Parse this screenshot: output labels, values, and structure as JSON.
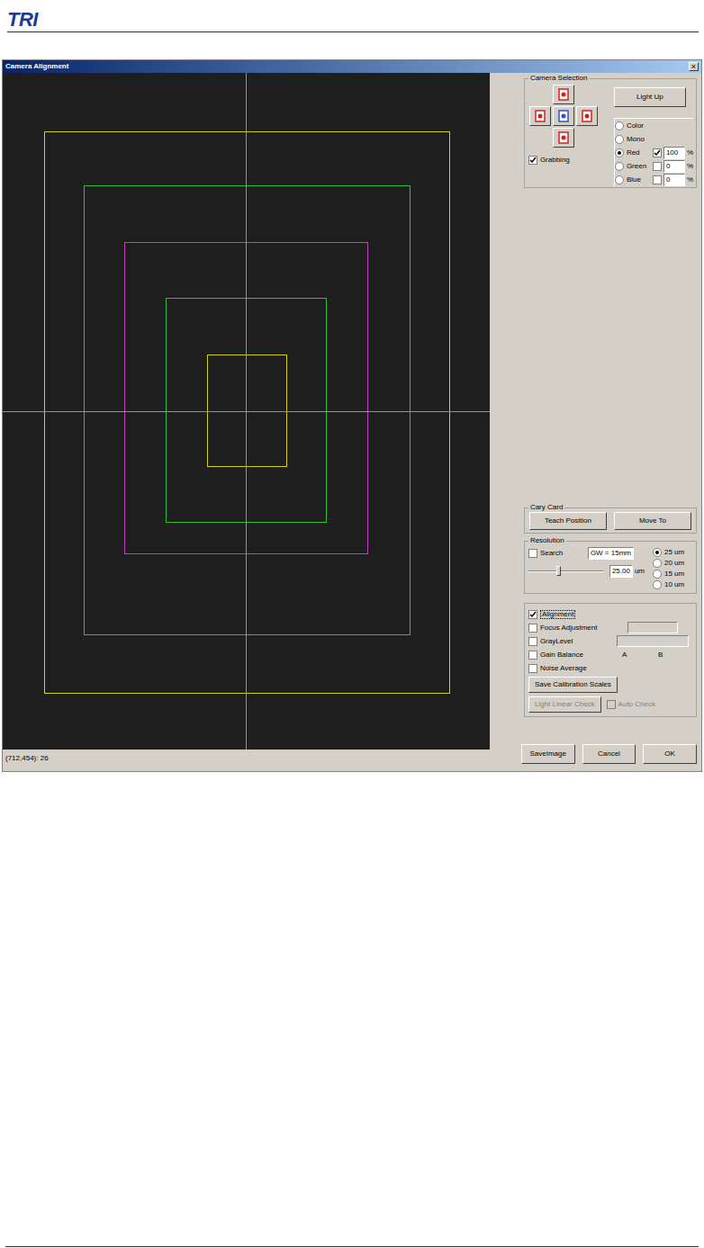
{
  "header": {
    "logo": "TRI"
  },
  "window": {
    "title": "Camera Alignment",
    "close": "×"
  },
  "camera_selection": {
    "title": "Camera Selection",
    "cameras": [
      {
        "selected": false
      },
      {
        "selected": false
      },
      {
        "selected": true
      },
      {
        "selected": false
      },
      {
        "selected": false
      }
    ],
    "grabbing": {
      "label": "Grabbing",
      "checked": true
    },
    "light_up": "Light Up",
    "modes": [
      {
        "label": "Color",
        "selected": false
      },
      {
        "label": "Mono",
        "selected": false
      },
      {
        "label": "Red",
        "selected": true,
        "channel": {
          "checked": true,
          "value": "100",
          "unit": "%"
        }
      },
      {
        "label": "Green",
        "selected": false,
        "channel": {
          "checked": false,
          "value": "0",
          "unit": "%"
        }
      },
      {
        "label": "Blue",
        "selected": false,
        "channel": {
          "checked": false,
          "value": "0",
          "unit": "%"
        }
      }
    ]
  },
  "cary_card": {
    "title": "Cary Card",
    "buttons": [
      "Teach Position",
      "Move To"
    ]
  },
  "resolution": {
    "title": "Resolution",
    "search": {
      "label": "Search",
      "checked": false
    },
    "field": "GW = 15mm",
    "slider": {
      "level": 0.4
    },
    "value": "25.00",
    "unit": "um",
    "options": [
      {
        "label": "25 um",
        "selected": true
      },
      {
        "label": "20 um",
        "selected": false
      },
      {
        "label": "15 um",
        "selected": false
      },
      {
        "label": "10 um",
        "selected": false
      }
    ]
  },
  "options": {
    "rows": [
      {
        "kind": "check",
        "label": "Alignment",
        "checked": true
      },
      {
        "kind": "field",
        "label": "Focus Adjustment",
        "checked": false
      },
      {
        "kind": "widefield",
        "label": "GrayLevel",
        "checked": false
      },
      {
        "kind": "labels",
        "label": "Gain Balance",
        "checked": false,
        "labels": [
          "A",
          "B"
        ]
      },
      {
        "kind": "check",
        "label": "Noise Average",
        "checked": false
      }
    ],
    "save_button": "Save Calibration Scales",
    "linear_check": {
      "label": "Light Linear Check",
      "disabled": true
    },
    "auto_check": {
      "label": "Auto Check",
      "checked": false,
      "disabled": true
    }
  },
  "status_bar": {
    "text": "(712,454): 26"
  },
  "buttons": [
    "SaveImage",
    "Cancel",
    "OK"
  ]
}
